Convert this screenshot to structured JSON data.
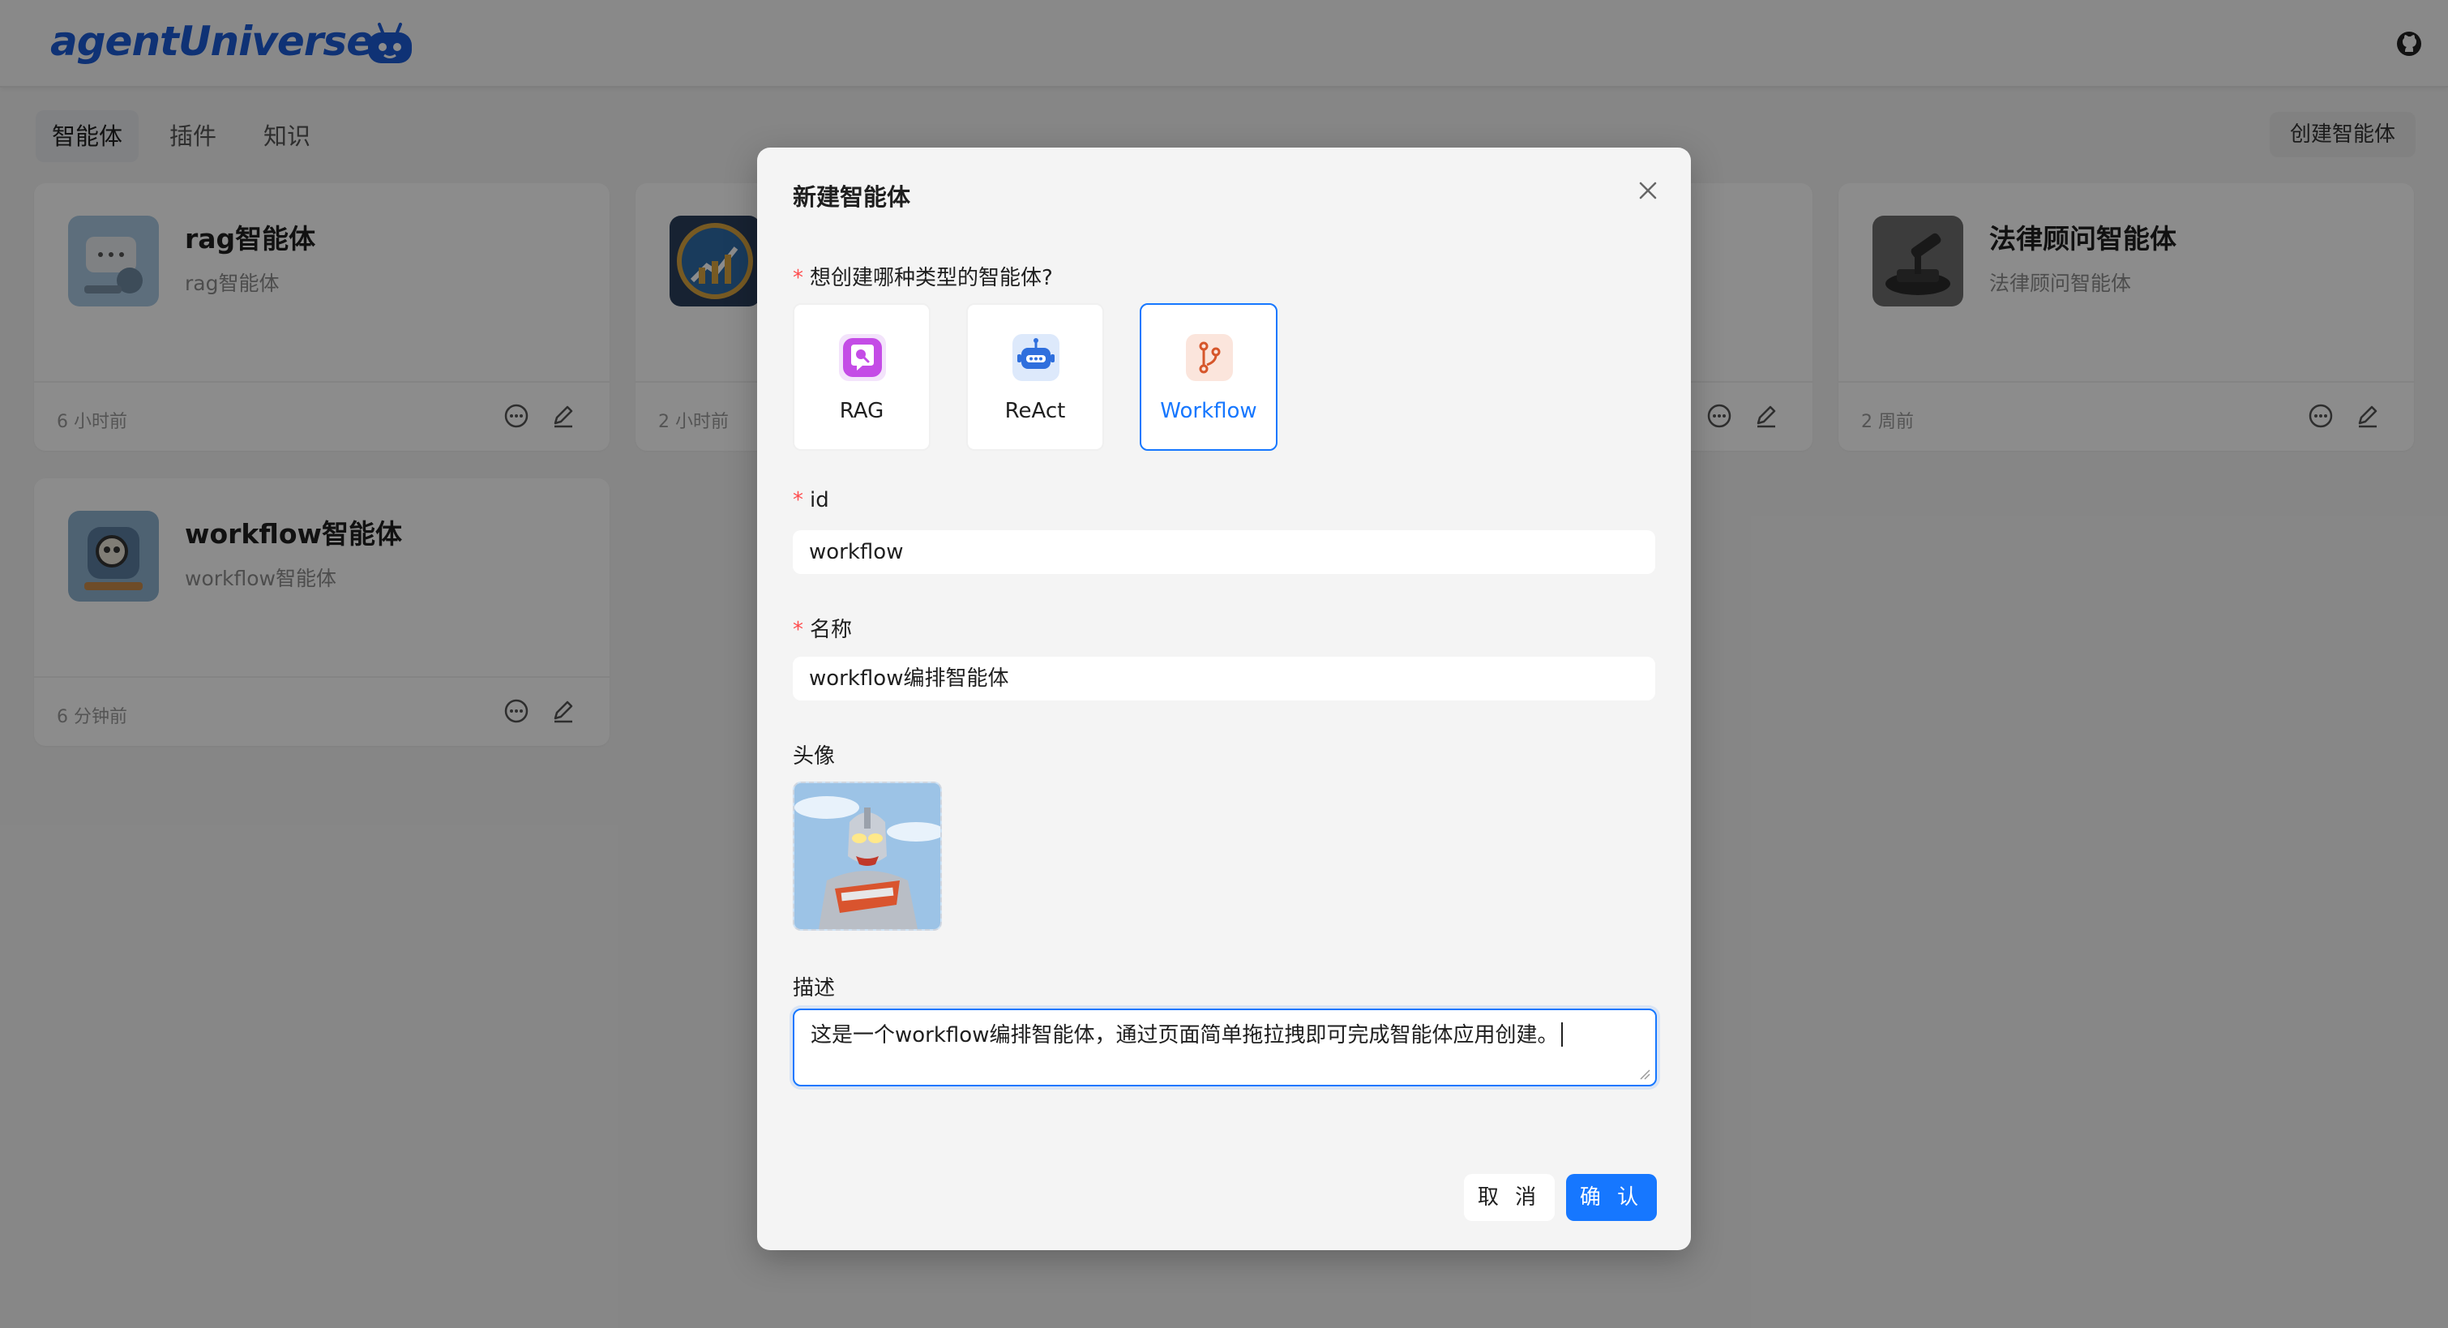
{
  "app": {
    "logo_text": "agentUniverse"
  },
  "nav": {
    "tabs": [
      {
        "label": "智能体",
        "active": true
      },
      {
        "label": "插件",
        "active": false
      },
      {
        "label": "知识",
        "active": false
      }
    ],
    "create_button": "创建智能体"
  },
  "cards": [
    {
      "title": "rag智能体",
      "desc": "rag智能体",
      "time": "6 小时前"
    },
    {
      "title": "",
      "desc": "",
      "time": "2 小时前"
    },
    {
      "title": "",
      "desc": "",
      "time": ""
    },
    {
      "title": "法律顾问智能体",
      "desc": "法律顾问智能体",
      "time": "2 周前"
    },
    {
      "title": "workflow智能体",
      "desc": "workflow智能体",
      "time": "6 分钟前"
    }
  ],
  "modal": {
    "title": "新建智能体",
    "type_question": "想创建哪种类型的智能体?",
    "types": [
      {
        "label": "RAG",
        "icon": "magnifier-bubble-icon"
      },
      {
        "label": "ReAct",
        "icon": "robot-icon"
      },
      {
        "label": "Workflow",
        "icon": "branch-icon",
        "selected": true
      }
    ],
    "id_label": "id",
    "id_value": "workflow",
    "name_label": "名称",
    "name_value": "workflow编排智能体",
    "avatar_label": "头像",
    "desc_label": "描述",
    "desc_value": "这是一个workflow编排智能体，通过页面简单拖拉拽即可完成智能体应用创建。",
    "cancel": "取 消",
    "ok": "确 认"
  },
  "colors": {
    "primary": "#1677ff",
    "required": "#ff4d4f",
    "logo": "#1d5bd6"
  }
}
